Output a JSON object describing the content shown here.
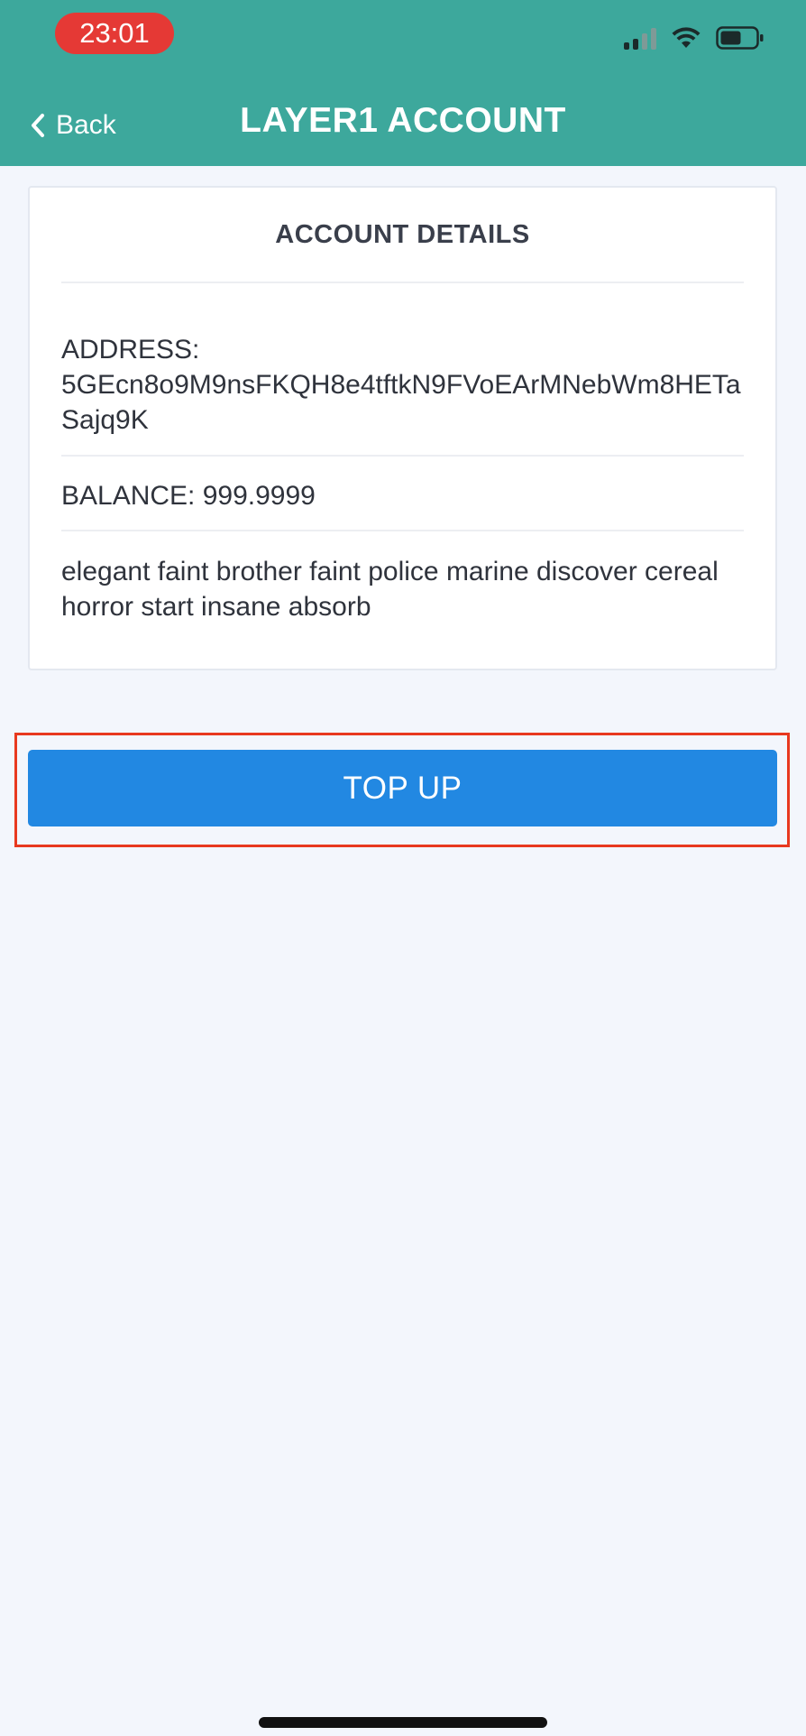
{
  "status_bar": {
    "time": "23:01",
    "time_pill_color": "#e53935",
    "icons": [
      "signal-icon",
      "wifi-icon",
      "battery-icon"
    ]
  },
  "nav": {
    "back_label": "Back",
    "back_icon": "chevron-left-icon",
    "title": "LAYER1 ACCOUNT",
    "background_color": "#3da89c"
  },
  "card": {
    "title": "ACCOUNT DETAILS",
    "address_label": "ADDRESS:",
    "address_value": "5GEcn8o9M9nsFKQH8e4tftkN9FVoEArMNebWm8HETaSajq9K",
    "balance_text": "BALANCE: 999.9999",
    "mnemonic": "elegant faint brother faint police marine discover cereal horror start insane absorb"
  },
  "actions": {
    "topup_label": "TOP UP",
    "topup_color": "#2288e2",
    "highlight_color": "#e8391f"
  }
}
